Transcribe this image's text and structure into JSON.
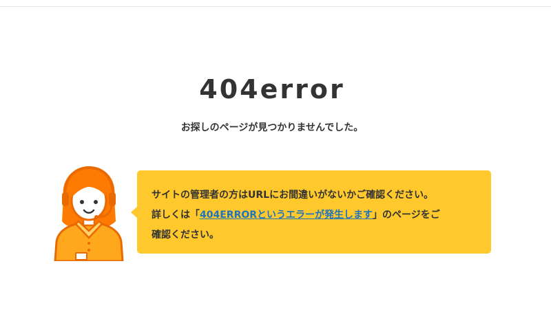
{
  "page": {
    "title": "404error",
    "subtitle": "お探しのページが見つかりませんでした。"
  },
  "notice": {
    "line1": "サイトの管理者の方はURLにお間違いがないかご確認ください。",
    "line2_before": "詳しくは「",
    "link_text": "404ERRORというエラーが発生します",
    "line2_after": "」のページをご",
    "line3": "確認ください。"
  },
  "illustration": {
    "icon": "support-operator-icon",
    "colors": {
      "hair": "#ff7a00",
      "outline": "#e86a00",
      "skin": "#ffffff",
      "shirt": "#ffa81e",
      "collar": "#ffd36b"
    }
  },
  "colors": {
    "bubble": "#ffc82c",
    "link": "#1e73be",
    "text": "#333333"
  }
}
